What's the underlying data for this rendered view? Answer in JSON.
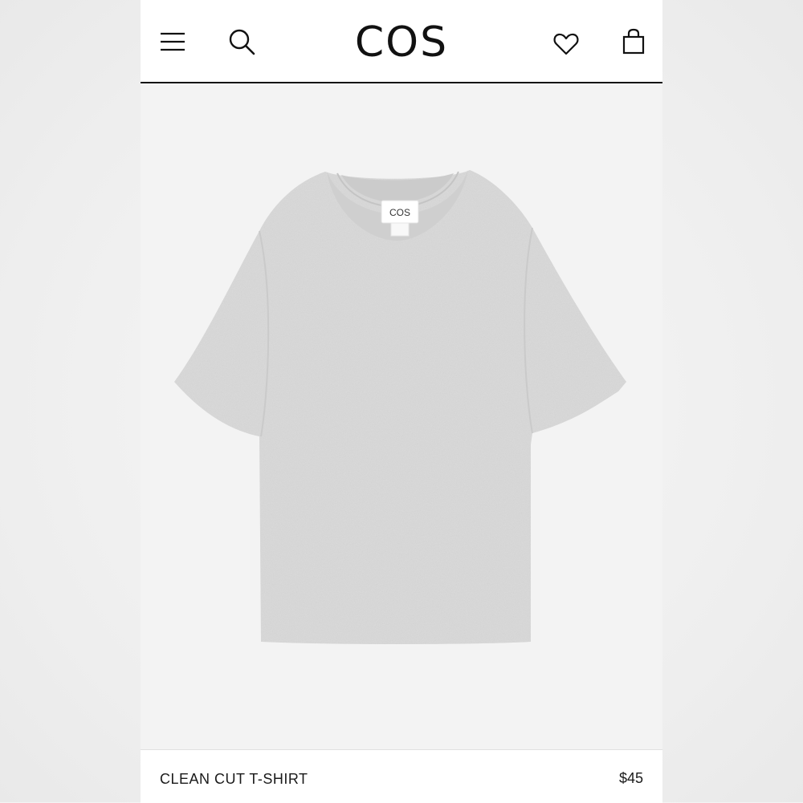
{
  "header": {
    "brand": "COS",
    "menu_icon": "hamburger-menu-icon",
    "search_icon": "search-icon",
    "wishlist_icon": "heart-icon",
    "bag_icon": "shopping-bag-icon"
  },
  "product": {
    "name": "CLEAN CUT T-SHIRT",
    "price": "$45",
    "label_brand": "COS",
    "color": "#d9d9d9"
  }
}
